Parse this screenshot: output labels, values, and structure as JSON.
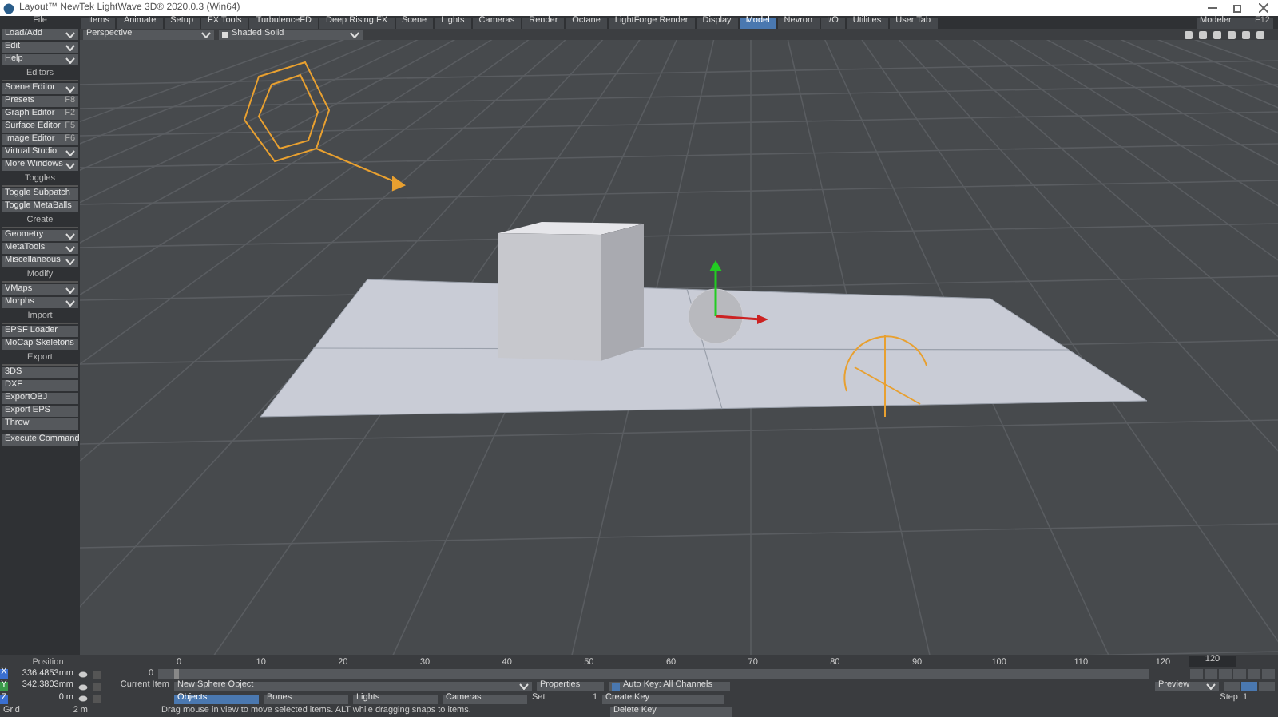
{
  "window": {
    "title": "Layout™ NewTek LightWave 3D® 2020.0.3 (Win64)"
  },
  "file_header": "File",
  "menu_tabs": [
    {
      "label": "Items",
      "selected": false
    },
    {
      "label": "Animate",
      "selected": false
    },
    {
      "label": "Setup",
      "selected": false
    },
    {
      "label": "FX Tools",
      "selected": false
    },
    {
      "label": "TurbulenceFD",
      "selected": false
    },
    {
      "label": "Deep Rising FX",
      "selected": false
    },
    {
      "label": "Scene",
      "selected": false
    },
    {
      "label": "Lights",
      "selected": false
    },
    {
      "label": "Cameras",
      "selected": false
    },
    {
      "label": "Render",
      "selected": false
    },
    {
      "label": "Octane",
      "selected": false
    },
    {
      "label": "LightForge Render",
      "selected": false
    },
    {
      "label": "Display",
      "selected": false
    },
    {
      "label": "Model",
      "selected": true
    },
    {
      "label": "Nevron",
      "selected": false
    },
    {
      "label": "I/O",
      "selected": false
    },
    {
      "label": "Utilities",
      "selected": false
    },
    {
      "label": "User Tab",
      "selected": false
    }
  ],
  "modeler": {
    "label": "Modeler",
    "shortcut": "F12"
  },
  "viewport": {
    "view": "Perspective",
    "shading": "Shaded Solid"
  },
  "sidebar": [
    {
      "items": [
        {
          "label": "Load/Add",
          "kind": "dropdown"
        },
        {
          "label": "Edit",
          "kind": "dropdown"
        },
        {
          "label": "Help",
          "kind": "dropdown"
        }
      ]
    },
    {
      "title": "Editors",
      "items": [
        {
          "label": "Scene Editor",
          "kind": "dropdown"
        },
        {
          "label": "Presets",
          "kind": "shortcut",
          "shortcut": "F8"
        },
        {
          "label": "Graph Editor",
          "kind": "shortcut",
          "shortcut": "F2"
        },
        {
          "label": "Surface Editor",
          "kind": "shortcut",
          "shortcut": "F5"
        },
        {
          "label": "Image Editor",
          "kind": "shortcut",
          "shortcut": "F6"
        },
        {
          "label": "Virtual Studio",
          "kind": "dropdown"
        },
        {
          "label": "More Windows",
          "kind": "dropdown"
        }
      ]
    },
    {
      "title": "Toggles",
      "items": [
        {
          "label": "Toggle Subpatch",
          "kind": "button"
        },
        {
          "label": "Toggle MetaBalls",
          "kind": "button"
        }
      ]
    },
    {
      "title": "Create",
      "items": [
        {
          "label": "Geometry",
          "kind": "dropdown"
        },
        {
          "label": "MetaTools",
          "kind": "dropdown"
        },
        {
          "label": "Miscellaneous",
          "kind": "dropdown"
        }
      ]
    },
    {
      "title": "Modify",
      "items": [
        {
          "label": "VMaps",
          "kind": "dropdown"
        },
        {
          "label": "Morphs",
          "kind": "dropdown"
        }
      ]
    },
    {
      "title": "Import",
      "items": [
        {
          "label": "EPSF Loader",
          "kind": "button"
        },
        {
          "label": "MoCap Skeletons",
          "kind": "button"
        }
      ]
    },
    {
      "title": "Export",
      "items": [
        {
          "label": "3DS",
          "kind": "button"
        },
        {
          "label": "DXF",
          "kind": "button"
        },
        {
          "label": "ExportOBJ",
          "kind": "button"
        },
        {
          "label": "Export EPS",
          "kind": "button"
        },
        {
          "label": "Throw",
          "kind": "button"
        }
      ]
    },
    {
      "items": [
        {
          "label": "Execute Command",
          "kind": "button"
        }
      ]
    }
  ],
  "position": {
    "label": "Position",
    "axes": [
      {
        "axis": "X",
        "value": "336.4853mm",
        "color": "#3a6fd0"
      },
      {
        "axis": "Y",
        "value": "342.3803mm",
        "color": "#3a9a4a"
      },
      {
        "axis": "Z",
        "value": "0 m",
        "color": "#3a6fd0"
      }
    ],
    "grid_label": "Grid",
    "grid_value": "2 m"
  },
  "timeline": {
    "start": "0",
    "ticks": [
      "0",
      "10",
      "20",
      "30",
      "40",
      "50",
      "60",
      "70",
      "80",
      "90",
      "100",
      "110",
      "120"
    ],
    "end": "120"
  },
  "current_item": {
    "label": "Current Item",
    "value": "New Sphere Object"
  },
  "item_filters": [
    {
      "label": "Objects",
      "selected": true
    },
    {
      "label": "Bones",
      "selected": false
    },
    {
      "label": "Lights",
      "selected": false
    },
    {
      "label": "Cameras",
      "selected": false
    }
  ],
  "properties": "Properties",
  "set": {
    "label": "Set",
    "value": "1"
  },
  "auto_key": {
    "label": "Auto Key: All Channels",
    "checked": true
  },
  "keys": [
    "Create Key",
    "Delete Key"
  ],
  "status": "Drag mouse in view to move selected items. ALT while dragging snaps to items.",
  "transport": {
    "preview": "Preview",
    "step_label": "Step",
    "step_value": "1"
  }
}
